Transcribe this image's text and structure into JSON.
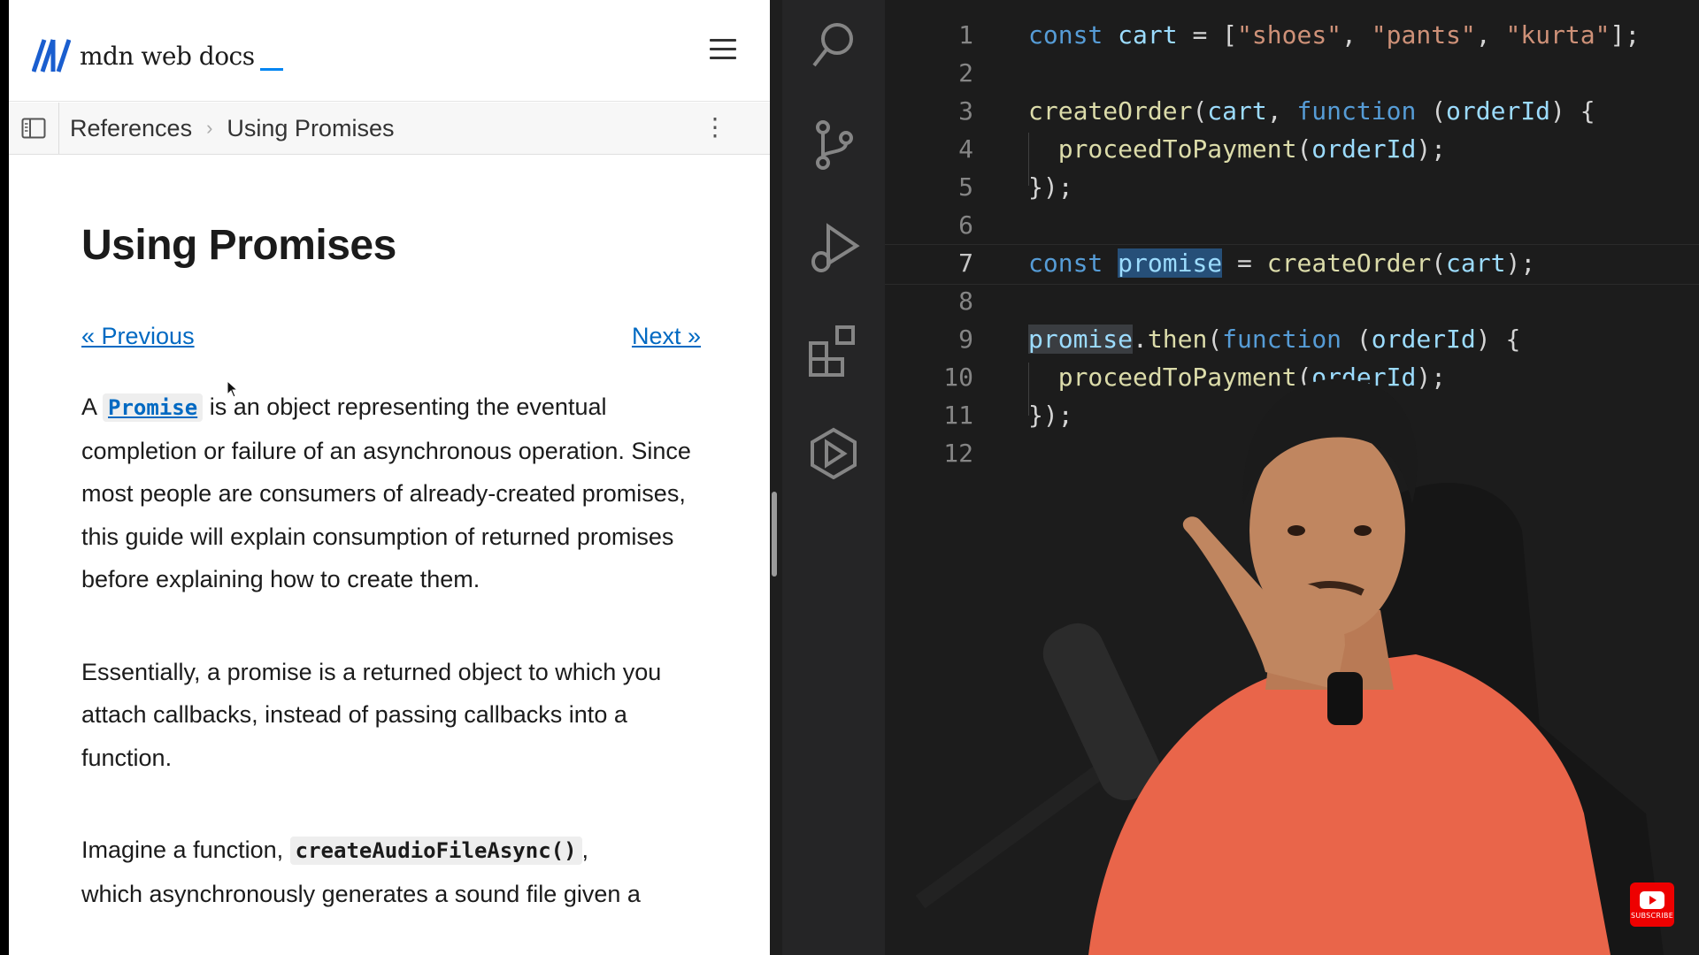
{
  "mdn": {
    "logo_text": "mdn web docs",
    "breadcrumb": {
      "references": "References",
      "current": "Using Promises"
    },
    "page_title": "Using Promises",
    "pager": {
      "previous": "« Previous",
      "next": "Next »"
    },
    "paragraph1": {
      "prefix": "A ",
      "code": "Promise",
      "suffix": " is an object representing the eventual completion or failure of an asynchronous operation. Since most people are consumers of already-created promises, this guide will explain consumption of returned promises before explaining how to create them."
    },
    "paragraph2": "Essentially, a promise is a returned object to which you attach callbacks, instead of passing callbacks into a function.",
    "paragraph3": {
      "prefix": "Imagine a function, ",
      "code": "createAudioFileAsync()",
      "suffix": ",",
      "line2": "which asynchronously generates a sound file given a"
    }
  },
  "editor": {
    "line_numbers": [
      "1",
      "2",
      "3",
      "4",
      "5",
      "6",
      "7",
      "8",
      "9",
      "10",
      "11",
      "12"
    ],
    "active_line": "7"
  },
  "youtube": {
    "subscribe_label": "SUBSCRIBE"
  },
  "colors": {
    "mdn_link": "#0069c2",
    "keyword": "#569cd6",
    "variable": "#9cdcfe",
    "function": "#dcdcaa",
    "string": "#ce9178",
    "selection": "#264f78",
    "shirt": "#e9654a"
  }
}
